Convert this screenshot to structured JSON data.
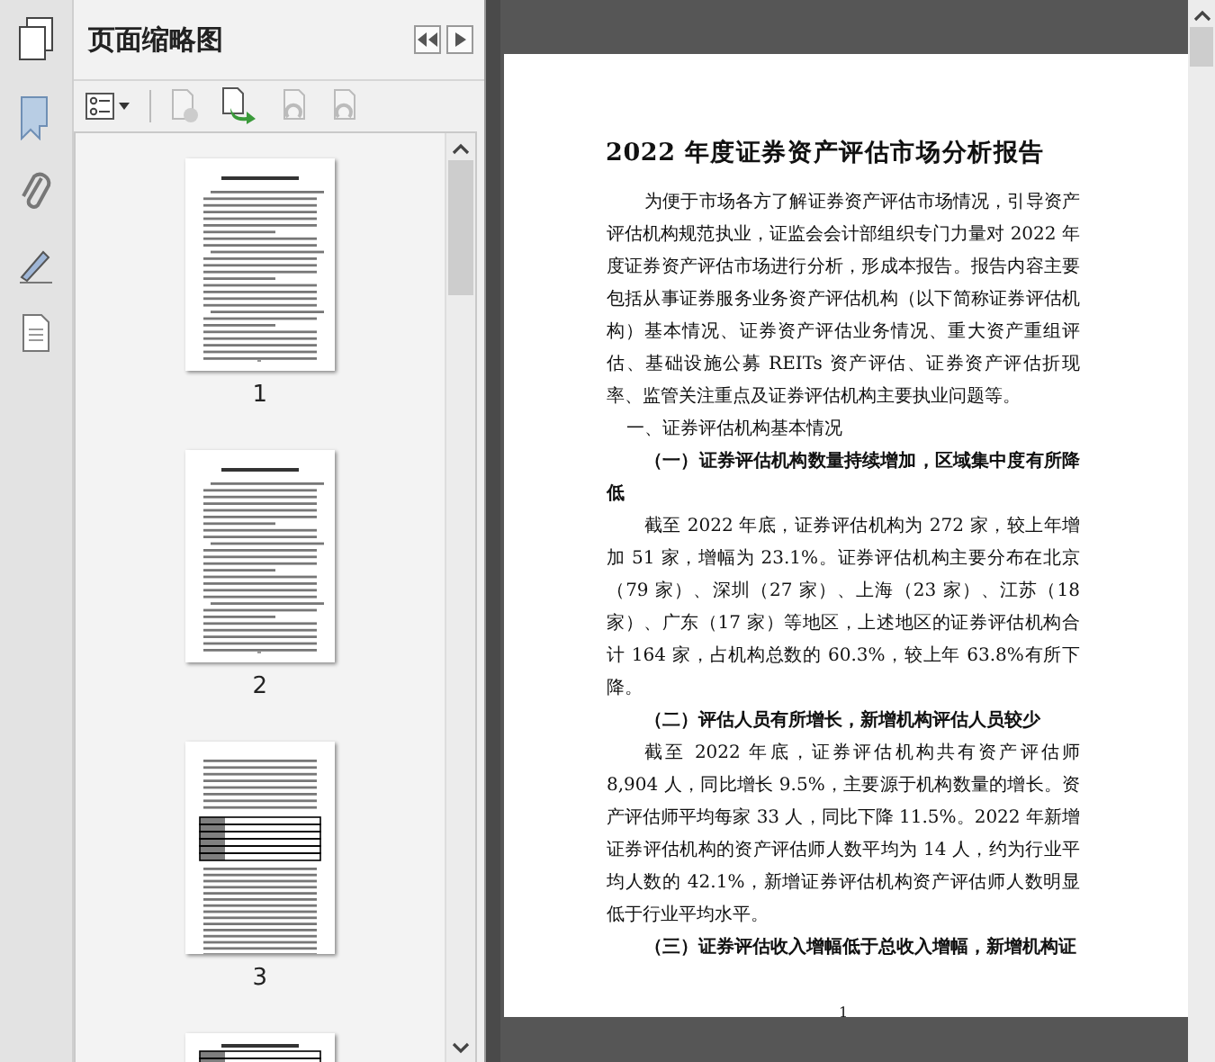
{
  "panel": {
    "title": "页面缩略图"
  },
  "thumbnails": [
    {
      "kind": "text",
      "label": "1"
    },
    {
      "kind": "text",
      "label": "2"
    },
    {
      "kind": "table",
      "label": "3"
    },
    {
      "kind": "table_top"
    }
  ],
  "document": {
    "title": "2022 年度证券资产评估市场分析报告",
    "blocks": [
      {
        "kind": "para",
        "text": "为便于市场各方了解证券资产评估市场情况，引导资产评估机构规范执业，证监会会计部组织专门力量对 2022 年度证券资产评估市场进行分析，形成本报告。报告内容主要包括从事证券服务业务资产评估机构（以下简称证券评估机构）基本情况、证券资产评估业务情况、重大资产重组评估、基础设施公募 REITs 资产评估、证券资产评估折现率、监管关注重点及证券评估机构主要执业问题等。"
      },
      {
        "kind": "heading1",
        "text": "一、证券评估机构基本情况"
      },
      {
        "kind": "heading2",
        "text": "（一）证券评估机构数量持续增加，区域集中度有所降低"
      },
      {
        "kind": "para",
        "text": "截至 2022 年底，证券评估机构为 272 家，较上年增加 51 家，增幅为 23.1%。证券评估机构主要分布在北京（79 家）、深圳（27 家）、上海（23 家）、江苏（18 家）、广东（17 家）等地区，上述地区的证券评估机构合计 164 家，占机构总数的 60.3%，较上年 63.8%有所下降。"
      },
      {
        "kind": "heading2",
        "text": "（二）评估人员有所增长，新增机构评估人员较少"
      },
      {
        "kind": "para",
        "text": "截至 2022 年底，证券评估机构共有资产评估师 8,904 人，同比增长 9.5%，主要源于机构数量的增长。资产评估师平均每家 33 人，同比下降 11.5%。2022 年新增证券评估机构的资产评估师人数平均为 14 人，约为行业平均人数的 42.1%，新增证券评估机构资产评估师人数明显低于行业平均水平。"
      },
      {
        "kind": "heading2",
        "text": "（三）证券评估收入增幅低于总收入增幅，新增机构证"
      }
    ],
    "page_number": "1"
  }
}
